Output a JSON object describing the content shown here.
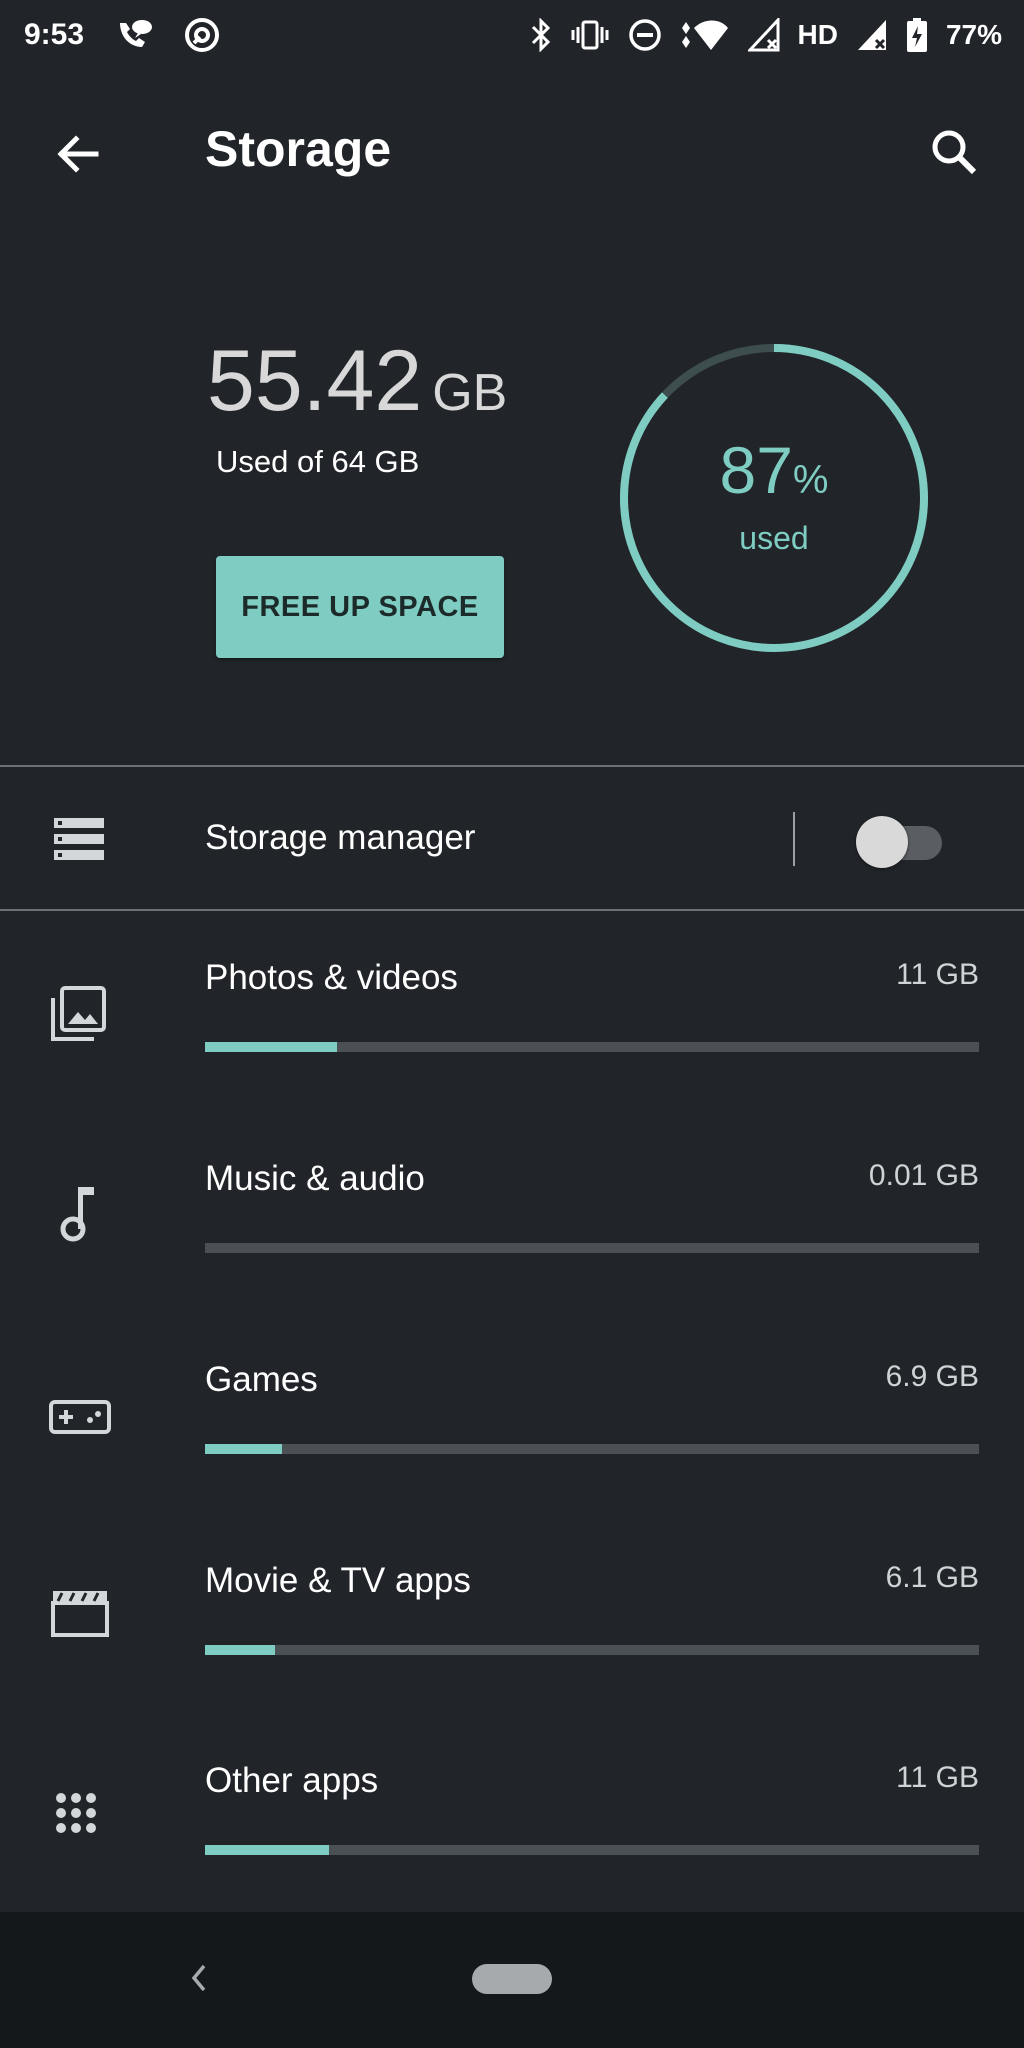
{
  "status_bar": {
    "time": "9:53",
    "network": "HD",
    "battery": "77%",
    "icons_left": [
      "wifi-calling-icon",
      "assistant-icon"
    ],
    "icons_right": [
      "bluetooth-icon",
      "vibrate-icon",
      "do-not-disturb-icon",
      "wifi-icon",
      "signal-icon",
      "signal-2-icon",
      "battery-charging-icon"
    ]
  },
  "header": {
    "title": "Storage",
    "back_icon": "arrow-back-icon",
    "search_icon": "search-icon"
  },
  "summary": {
    "used_value": "55.42",
    "used_unit": "GB",
    "used_subtitle": "Used of 64 GB",
    "free_button": "FREE UP SPACE",
    "percent": "87",
    "percent_symbol": "%",
    "percent_label": "used",
    "percent_value": 0.87,
    "accent_color": "#7fcdc2"
  },
  "storage_manager": {
    "label": "Storage manager",
    "icon": "storage-icon",
    "enabled": false
  },
  "categories": [
    {
      "label": "Photos & videos",
      "size": "11 GB",
      "icon": "photo-library-icon",
      "fraction": 0.17
    },
    {
      "label": "Music & audio",
      "size": "0.01 GB",
      "icon": "music-note-icon",
      "fraction": 0.0
    },
    {
      "label": "Games",
      "size": "6.9 GB",
      "icon": "gamepad-icon",
      "fraction": 0.1
    },
    {
      "label": "Movie & TV apps",
      "size": "6.1 GB",
      "icon": "movie-icon",
      "fraction": 0.09
    },
    {
      "label": "Other apps",
      "size": "11 GB",
      "icon": "apps-grid-icon",
      "fraction": 0.16
    }
  ],
  "nav_bar": {
    "back_icon": "nav-back-icon",
    "home_icon": "nav-home-pill"
  }
}
